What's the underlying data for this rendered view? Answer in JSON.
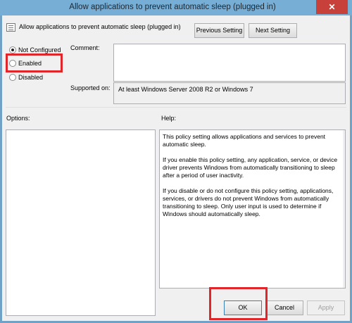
{
  "window": {
    "title": "Allow applications to prevent automatic sleep (plugged in)",
    "close_glyph": "✕"
  },
  "header": {
    "policy_title": "Allow applications to prevent automatic sleep (plugged in)",
    "previous_label": "Previous Setting",
    "next_label": "Next Setting"
  },
  "state": {
    "options": [
      {
        "label": "Not Configured",
        "checked": true
      },
      {
        "label": "Enabled",
        "checked": false
      },
      {
        "label": "Disabled",
        "checked": false
      }
    ]
  },
  "comment": {
    "label": "Comment:",
    "value": ""
  },
  "supported": {
    "label": "Supported on:",
    "value": "At least Windows Server 2008 R2 or Windows 7"
  },
  "options_panel": {
    "label": "Options:"
  },
  "help_panel": {
    "label": "Help:",
    "paragraphs": [
      "This policy setting allows applications and services to prevent automatic sleep.",
      "If you enable this policy setting, any application, service, or device driver prevents Windows from automatically transitioning to sleep after a period of user inactivity.",
      "If you disable or do not configure this policy setting, applications, services, or drivers do not prevent Windows from automatically transitioning to sleep. Only user input is used to determine if Windows should automatically sleep."
    ]
  },
  "footer": {
    "ok_label": "OK",
    "cancel_label": "Cancel",
    "apply_label": "Apply"
  },
  "colors": {
    "highlight": "#e0262b",
    "close_button": "#c7403a",
    "titlebar": "#76aed6"
  }
}
